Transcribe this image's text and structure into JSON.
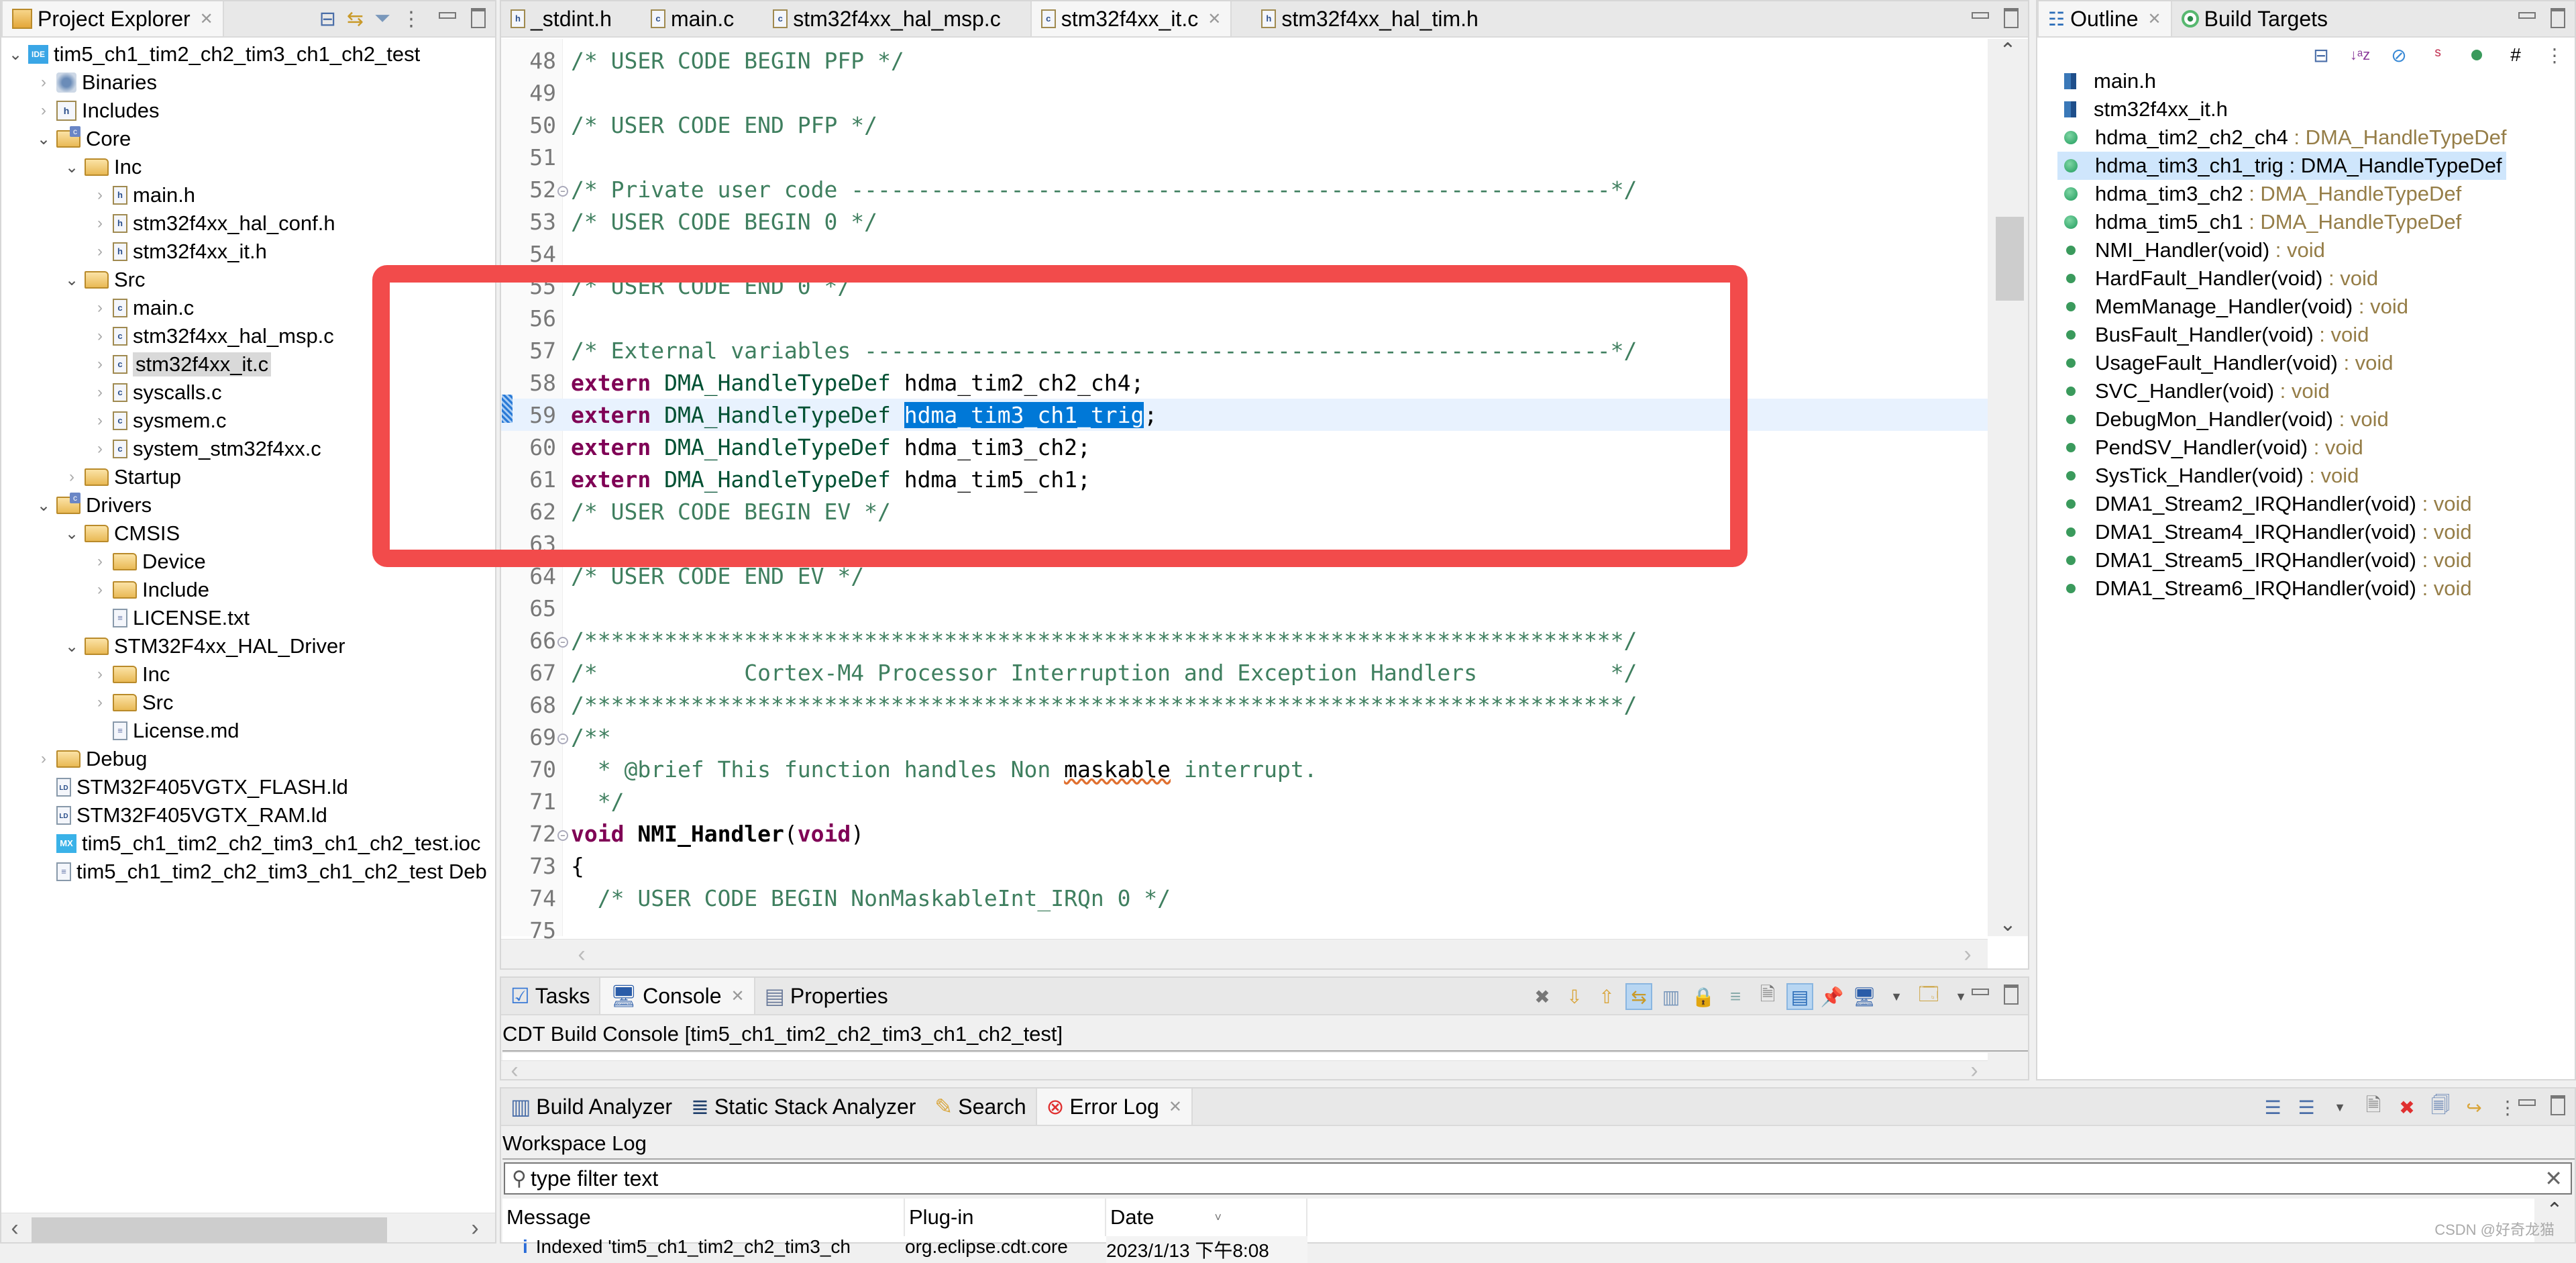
{
  "project_explorer": {
    "title": "Project Explorer",
    "tree": [
      {
        "label": "tim5_ch1_tim2_ch2_tim3_ch1_ch2_test",
        "depth": 0,
        "twisty": "open",
        "icon": "ide-project-icon"
      },
      {
        "label": "Binaries",
        "depth": 1,
        "twisty": "closed",
        "icon": "binaries-icon"
      },
      {
        "label": "Includes",
        "depth": 1,
        "twisty": "closed",
        "icon": "includes-icon"
      },
      {
        "label": "Core",
        "depth": 1,
        "twisty": "open",
        "icon": "source-folder-icon"
      },
      {
        "label": "Inc",
        "depth": 2,
        "twisty": "open",
        "icon": "folder-icon"
      },
      {
        "label": "main.h",
        "depth": 3,
        "twisty": "closed",
        "icon": "h-file-icon"
      },
      {
        "label": "stm32f4xx_hal_conf.h",
        "depth": 3,
        "twisty": "closed",
        "icon": "h-file-icon"
      },
      {
        "label": "stm32f4xx_it.h",
        "depth": 3,
        "twisty": "closed",
        "icon": "h-file-icon"
      },
      {
        "label": "Src",
        "depth": 2,
        "twisty": "open",
        "icon": "folder-icon"
      },
      {
        "label": "main.c",
        "depth": 3,
        "twisty": "closed",
        "icon": "c-file-icon"
      },
      {
        "label": "stm32f4xx_hal_msp.c",
        "depth": 3,
        "twisty": "closed",
        "icon": "c-file-icon"
      },
      {
        "label": "stm32f4xx_it.c",
        "depth": 3,
        "twisty": "closed",
        "icon": "c-file-icon",
        "selected": true
      },
      {
        "label": "syscalls.c",
        "depth": 3,
        "twisty": "closed",
        "icon": "c-file-icon"
      },
      {
        "label": "sysmem.c",
        "depth": 3,
        "twisty": "closed",
        "icon": "c-file-icon"
      },
      {
        "label": "system_stm32f4xx.c",
        "depth": 3,
        "twisty": "closed",
        "icon": "c-file-icon"
      },
      {
        "label": "Startup",
        "depth": 2,
        "twisty": "closed",
        "icon": "folder-icon"
      },
      {
        "label": "Drivers",
        "depth": 1,
        "twisty": "open",
        "icon": "source-folder-icon"
      },
      {
        "label": "CMSIS",
        "depth": 2,
        "twisty": "open",
        "icon": "folder-icon"
      },
      {
        "label": "Device",
        "depth": 3,
        "twisty": "closed",
        "icon": "folder-icon"
      },
      {
        "label": "Include",
        "depth": 3,
        "twisty": "closed",
        "icon": "folder-icon"
      },
      {
        "label": "LICENSE.txt",
        "depth": 3,
        "twisty": "none",
        "icon": "text-file-icon"
      },
      {
        "label": "STM32F4xx_HAL_Driver",
        "depth": 2,
        "twisty": "open",
        "icon": "folder-icon"
      },
      {
        "label": "Inc",
        "depth": 3,
        "twisty": "closed",
        "icon": "folder-icon"
      },
      {
        "label": "Src",
        "depth": 3,
        "twisty": "closed",
        "icon": "folder-icon"
      },
      {
        "label": "License.md",
        "depth": 3,
        "twisty": "none",
        "icon": "text-file-icon"
      },
      {
        "label": "Debug",
        "depth": 1,
        "twisty": "closed",
        "icon": "folder-icon"
      },
      {
        "label": "STM32F405VGTX_FLASH.ld",
        "depth": 1,
        "twisty": "none",
        "icon": "ld-file-icon"
      },
      {
        "label": "STM32F405VGTX_RAM.ld",
        "depth": 1,
        "twisty": "none",
        "icon": "ld-file-icon"
      },
      {
        "label": "tim5_ch1_tim2_ch2_tim3_ch1_ch2_test.ioc",
        "depth": 1,
        "twisty": "none",
        "icon": "mx-file-icon"
      },
      {
        "label": "tim5_ch1_tim2_ch2_tim3_ch1_ch2_test Deb",
        "depth": 1,
        "twisty": "none",
        "icon": "text-file-icon"
      }
    ]
  },
  "editor": {
    "tabs": [
      {
        "label": "_stdint.h",
        "icon": "h-file-icon",
        "active": false
      },
      {
        "label": "main.c",
        "icon": "c-file-icon",
        "active": false
      },
      {
        "label": "stm32f4xx_hal_msp.c",
        "icon": "c-file-icon",
        "active": false
      },
      {
        "label": "stm32f4xx_it.c",
        "icon": "c-file-icon",
        "active": true
      },
      {
        "label": "stm32f4xx_hal_tim.h",
        "icon": "h-file-icon",
        "active": false
      }
    ],
    "lines": [
      {
        "n": "48",
        "fold": false,
        "tokens": [
          [
            "cmt",
            "/* USER CODE BEGIN PFP */"
          ]
        ]
      },
      {
        "n": "49",
        "fold": false,
        "tokens": []
      },
      {
        "n": "50",
        "fold": false,
        "tokens": [
          [
            "cmt",
            "/* USER CODE END PFP */"
          ]
        ]
      },
      {
        "n": "51",
        "fold": false,
        "tokens": []
      },
      {
        "n": "52",
        "fold": true,
        "tokens": [
          [
            "cmt",
            "/* Private user code ---------------------------------------------------------*/"
          ]
        ]
      },
      {
        "n": "53",
        "fold": false,
        "tokens": [
          [
            "cmt",
            "/* USER CODE BEGIN 0 */"
          ]
        ]
      },
      {
        "n": "54",
        "fold": false,
        "tokens": []
      },
      {
        "n": "55",
        "fold": false,
        "tokens": [
          [
            "cmt",
            "/* USER CODE END 0 */"
          ]
        ]
      },
      {
        "n": "56",
        "fold": false,
        "tokens": []
      },
      {
        "n": "57",
        "fold": false,
        "tokens": [
          [
            "cmt",
            "/* External variables --------------------------------------------------------*/"
          ]
        ]
      },
      {
        "n": "58",
        "fold": false,
        "tokens": [
          [
            "kw",
            "extern"
          ],
          [
            "plain",
            " "
          ],
          [
            "typ",
            "DMA_HandleTypeDef"
          ],
          [
            "plain",
            " "
          ],
          [
            "ident",
            "hdma_tim2_ch2_ch4"
          ],
          [
            "ident",
            ";"
          ]
        ]
      },
      {
        "n": "59",
        "fold": false,
        "current": true,
        "tokens": [
          [
            "kw",
            "extern"
          ],
          [
            "plain",
            " "
          ],
          [
            "typ",
            "DMA_HandleTypeDef"
          ],
          [
            "plain",
            " "
          ],
          [
            "selword",
            "hdma_tim3_ch1_trig"
          ],
          [
            "ident",
            ";"
          ]
        ]
      },
      {
        "n": "60",
        "fold": false,
        "tokens": [
          [
            "kw",
            "extern"
          ],
          [
            "plain",
            " "
          ],
          [
            "typ",
            "DMA_HandleTypeDef"
          ],
          [
            "plain",
            " "
          ],
          [
            "ident",
            "hdma_tim3_ch2"
          ],
          [
            "ident",
            ";"
          ]
        ]
      },
      {
        "n": "61",
        "fold": false,
        "tokens": [
          [
            "kw",
            "extern"
          ],
          [
            "plain",
            " "
          ],
          [
            "typ",
            "DMA_HandleTypeDef"
          ],
          [
            "plain",
            " "
          ],
          [
            "ident",
            "hdma_tim5_ch1"
          ],
          [
            "ident",
            ";"
          ]
        ]
      },
      {
        "n": "62",
        "fold": false,
        "tokens": [
          [
            "cmt",
            "/* USER CODE BEGIN EV */"
          ]
        ]
      },
      {
        "n": "63",
        "fold": false,
        "tokens": []
      },
      {
        "n": "64",
        "fold": false,
        "tokens": [
          [
            "cmt",
            "/* USER CODE END EV */"
          ]
        ]
      },
      {
        "n": "65",
        "fold": false,
        "tokens": []
      },
      {
        "n": "66",
        "fold": true,
        "tokens": [
          [
            "cmt",
            "/******************************************************************************/"
          ]
        ]
      },
      {
        "n": "67",
        "fold": false,
        "tokens": [
          [
            "cmt",
            "/*           Cortex-M4 Processor Interruption and Exception Handlers          */"
          ]
        ]
      },
      {
        "n": "68",
        "fold": false,
        "tokens": [
          [
            "cmt",
            "/******************************************************************************/"
          ]
        ]
      },
      {
        "n": "69",
        "fold": true,
        "tokens": [
          [
            "cmt",
            "/**"
          ]
        ]
      },
      {
        "n": "70",
        "fold": false,
        "tokens": [
          [
            "cmt",
            "  * @brief This function handles Non "
          ],
          [
            "spell",
            "maskable"
          ],
          [
            "cmt",
            " interrupt."
          ]
        ]
      },
      {
        "n": "71",
        "fold": false,
        "tokens": [
          [
            "cmt",
            "  */"
          ]
        ]
      },
      {
        "n": "72",
        "fold": true,
        "tokens": [
          [
            "kw",
            "void"
          ],
          [
            "plain",
            " "
          ],
          [
            "fn",
            "NMI_Handler"
          ],
          [
            "ident",
            "("
          ],
          [
            "kw",
            "void"
          ],
          [
            "ident",
            ")"
          ]
        ]
      },
      {
        "n": "73",
        "fold": false,
        "tokens": [
          [
            "ident",
            "{"
          ]
        ]
      },
      {
        "n": "74",
        "fold": false,
        "tokens": [
          [
            "cmt",
            "  /* USER CODE BEGIN NonMaskableInt_IRQn 0 */"
          ]
        ]
      },
      {
        "n": "75",
        "fold": false,
        "tokens": []
      }
    ]
  },
  "outline": {
    "tabs": [
      {
        "label": "Outline",
        "active": true
      },
      {
        "label": "Build Targets",
        "active": false
      }
    ],
    "items": [
      {
        "name": "main.h",
        "type": "",
        "kind": "include"
      },
      {
        "name": "stm32f4xx_it.h",
        "type": "",
        "kind": "include"
      },
      {
        "name": "hdma_tim2_ch2_ch4",
        "type": " : DMA_HandleTypeDef",
        "kind": "variable"
      },
      {
        "name": "hdma_tim3_ch1_trig",
        "type": " : DMA_HandleTypeDef",
        "kind": "variable",
        "selected": true
      },
      {
        "name": "hdma_tim3_ch2",
        "type": " : DMA_HandleTypeDef",
        "kind": "variable"
      },
      {
        "name": "hdma_tim5_ch1",
        "type": " : DMA_HandleTypeDef",
        "kind": "variable"
      },
      {
        "name": "NMI_Handler(void)",
        "type": " : void",
        "kind": "function"
      },
      {
        "name": "HardFault_Handler(void)",
        "type": " : void",
        "kind": "function"
      },
      {
        "name": "MemManage_Handler(void)",
        "type": " : void",
        "kind": "function"
      },
      {
        "name": "BusFault_Handler(void)",
        "type": " : void",
        "kind": "function"
      },
      {
        "name": "UsageFault_Handler(void)",
        "type": " : void",
        "kind": "function"
      },
      {
        "name": "SVC_Handler(void)",
        "type": " : void",
        "kind": "function"
      },
      {
        "name": "DebugMon_Handler(void)",
        "type": " : void",
        "kind": "function"
      },
      {
        "name": "PendSV_Handler(void)",
        "type": " : void",
        "kind": "function"
      },
      {
        "name": "SysTick_Handler(void)",
        "type": " : void",
        "kind": "function"
      },
      {
        "name": "DMA1_Stream2_IRQHandler(void)",
        "type": " : void",
        "kind": "function"
      },
      {
        "name": "DMA1_Stream4_IRQHandler(void)",
        "type": " : void",
        "kind": "function"
      },
      {
        "name": "DMA1_Stream5_IRQHandler(void)",
        "type": " : void",
        "kind": "function"
      },
      {
        "name": "DMA1_Stream6_IRQHandler(void)",
        "type": " : void",
        "kind": "function"
      }
    ]
  },
  "console": {
    "tabs": [
      {
        "label": "Tasks",
        "active": false
      },
      {
        "label": "Console",
        "active": true
      },
      {
        "label": "Properties",
        "active": false
      }
    ],
    "title": "CDT Build Console [tim5_ch1_tim2_ch2_tim3_ch1_ch2_test]"
  },
  "errorlog": {
    "tabs": [
      {
        "label": "Build Analyzer",
        "active": false
      },
      {
        "label": "Static Stack Analyzer",
        "active": false
      },
      {
        "label": "Search",
        "active": false
      },
      {
        "label": "Error Log",
        "active": true
      }
    ],
    "title": "Workspace Log",
    "filter_placeholder": "type filter text",
    "columns": [
      "Message",
      "Plug-in",
      "Date"
    ],
    "rows": [
      {
        "message": "Indexed 'tim5_ch1_tim2_ch2_tim3_ch",
        "plugin": "org.eclipse.cdt.core",
        "date": "2023/1/13 下午8:08"
      }
    ]
  },
  "watermark": "CSDN @好奇龙猫",
  "colors": {
    "highlight_box": "#f24b4b",
    "selection": "#0078d7",
    "current_line": "#e8f2fe",
    "comment": "#3f7f5f",
    "keyword": "#7f0055"
  }
}
